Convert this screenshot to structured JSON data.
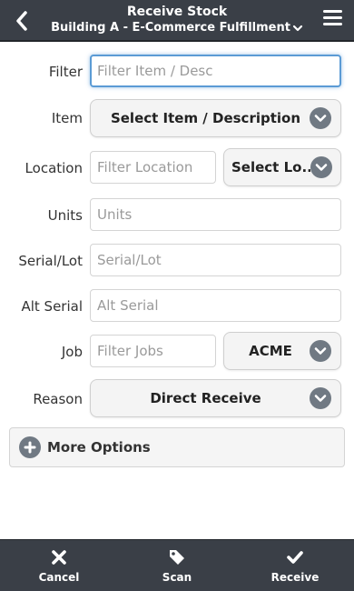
{
  "header": {
    "title": "Receive Stock",
    "subtitle": "Building A - E-Commerce Fulfillment"
  },
  "form": {
    "filter": {
      "label": "Filter",
      "placeholder": "Filter Item / Desc"
    },
    "item": {
      "label": "Item",
      "select": "Select Item / Description"
    },
    "location": {
      "label": "Location",
      "placeholder": "Filter Location",
      "select": "Select Lo..."
    },
    "units": {
      "label": "Units",
      "placeholder": "Units"
    },
    "serial_lot": {
      "label": "Serial/Lot",
      "placeholder": "Serial/Lot"
    },
    "alt_serial": {
      "label": "Alt Serial",
      "placeholder": "Alt Serial"
    },
    "job": {
      "label": "Job",
      "placeholder": "Filter Jobs",
      "select": "ACME"
    },
    "reason": {
      "label": "Reason",
      "select": "Direct Receive"
    }
  },
  "more_options": {
    "label": "More Options"
  },
  "footer": {
    "cancel": "Cancel",
    "scan": "Scan",
    "receive": "Receive"
  },
  "colors": {
    "header_bg": "#3a3f47",
    "focus_border": "#5b9bd5",
    "chevron_bg": "#707983"
  },
  "icons": {
    "back": "back-arrow-icon",
    "menu": "hamburger-menu-icon",
    "dropdown": "chevron-down-icon",
    "more": "plus-circle-icon",
    "cancel": "close-icon",
    "scan": "tag-icon",
    "receive": "checkmark-icon"
  }
}
